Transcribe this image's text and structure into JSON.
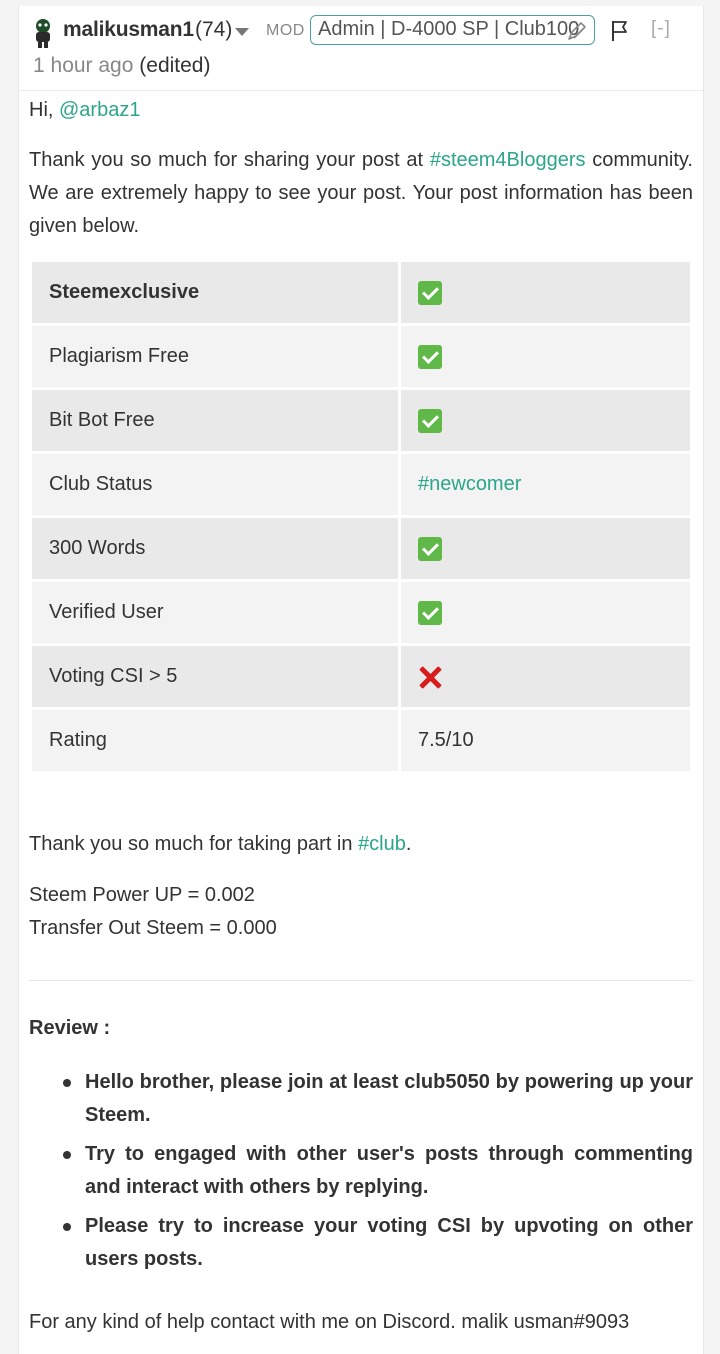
{
  "header": {
    "author": "malikusman1",
    "reputation": "(74)",
    "role": "MOD",
    "badge": "Admin | D-4000 SP | Club100",
    "collapse": "[-]",
    "time": "1 hour ago",
    "edited": "(edited)"
  },
  "body": {
    "greeting_prefix": "Hi, ",
    "mention": "@arbaz1",
    "intro_prefix": "Thank you so much for sharing your post at ",
    "intro_tag": "#steem4Bloggers",
    "intro_suffix": " community. We are extremely happy to see your post. Your post information has been given below."
  },
  "table": {
    "rows": [
      {
        "label": "Steemexclusive",
        "value": "✅",
        "kind": "check"
      },
      {
        "label": "Plagiarism Free",
        "value": "✅",
        "kind": "check"
      },
      {
        "label": "Bit Bot Free",
        "value": "✅",
        "kind": "check"
      },
      {
        "label": "Club Status",
        "value": "#newcomer",
        "kind": "link"
      },
      {
        "label": "300 Words",
        "value": "✅",
        "kind": "check"
      },
      {
        "label": "Verified User",
        "value": "✅",
        "kind": "check"
      },
      {
        "label": "Voting CSI > 5",
        "value": "❌",
        "kind": "cross"
      },
      {
        "label": "Rating",
        "value": "7.5/10",
        "kind": "text"
      }
    ]
  },
  "after_table": {
    "thanks_prefix": "Thank you so much for taking part in ",
    "thanks_tag": "#club",
    "thanks_suffix": ".",
    "power_up": "Steem Power UP = 0.002",
    "transfer_out": "Transfer Out Steem = 0.000"
  },
  "review": {
    "title": "Review :",
    "items": [
      "Hello brother, please join at least club5050 by powering up your Steem.",
      "Try to engaged with other user's posts through commenting and interact with others by replying.",
      "Please try to increase your voting CSI by upvoting on other users posts."
    ]
  },
  "footer": {
    "contact": "For any kind of help contact with me on Discord. malik usman#9093"
  },
  "colors": {
    "link": "#2ba68a",
    "badge_border": "#4ba2a0",
    "check": "#5fb847",
    "cross": "#d81b1b"
  },
  "icons": {
    "avatar": "avatar-icon",
    "dropdown": "chevron-down-icon",
    "edit": "pencil-icon",
    "flag": "flag-icon",
    "check": "check-mark-icon",
    "cross": "cross-mark-icon"
  }
}
